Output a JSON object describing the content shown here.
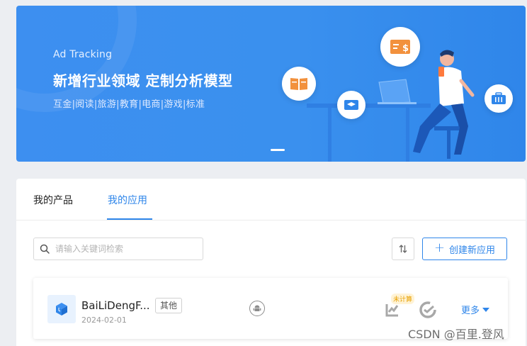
{
  "banner": {
    "kicker": "Ad Tracking",
    "headline": "新增行业领域 定制分析模型",
    "tags": "互金|阅读|旅游|教育|电商|游戏|标准"
  },
  "tabs": [
    {
      "label": "我的产品",
      "active": false
    },
    {
      "label": "我的应用",
      "active": true
    }
  ],
  "search": {
    "placeholder": "请输入关键词检索",
    "value": ""
  },
  "toolbar": {
    "create_label": "创建新应用"
  },
  "app": {
    "name": "BaiLiDengF...",
    "category": "其他",
    "date": "2024-02-01",
    "platform_icon": "android-icon",
    "status_tag": "未计算",
    "more_label": "更多"
  },
  "watermark": "CSDN @百里.登风",
  "colors": {
    "accent": "#2f86ea",
    "banner": "#3a90ee",
    "badge_bg": "#fff3d6",
    "badge_fg": "#e8a000"
  }
}
